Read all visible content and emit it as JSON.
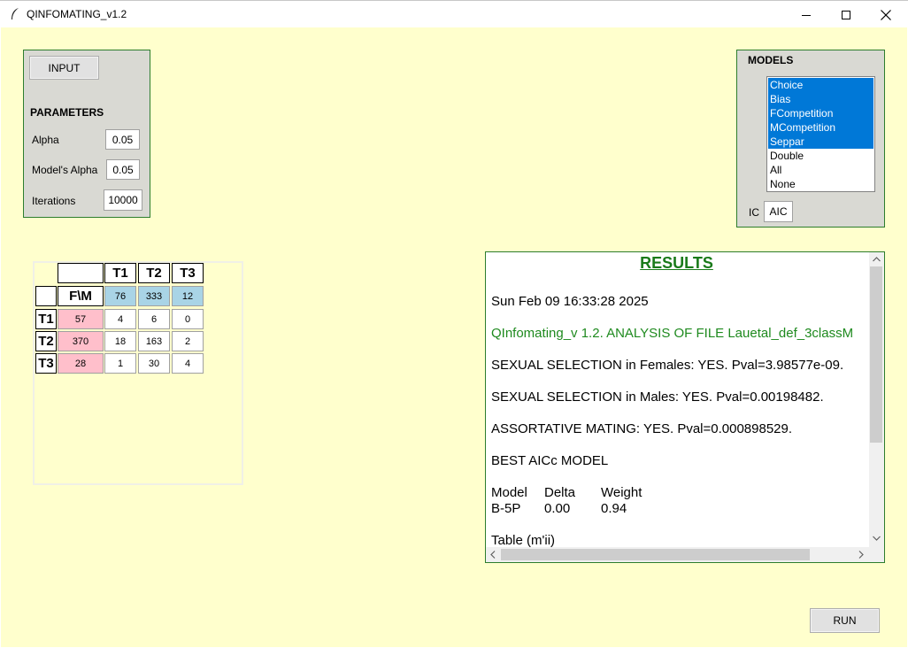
{
  "window": {
    "title": "QINFOMATING_v1.2"
  },
  "input_button": "INPUT",
  "parameters": {
    "heading": "PARAMETERS",
    "alpha_label": "Alpha",
    "alpha_value": "0.05",
    "model_alpha_label": "Model's Alpha",
    "model_alpha_value": "0.05",
    "iterations_label": "Iterations",
    "iterations_value": "10000"
  },
  "models": {
    "heading": "MODELS",
    "items": [
      {
        "label": "Choice",
        "selected": true
      },
      {
        "label": "Bias",
        "selected": true
      },
      {
        "label": "FCompetition",
        "selected": true
      },
      {
        "label": "MCompetition",
        "selected": true
      },
      {
        "label": "Seppar",
        "selected": true
      },
      {
        "label": "Double",
        "selected": false
      },
      {
        "label": "All",
        "selected": false
      },
      {
        "label": "None",
        "selected": false
      }
    ],
    "ic_label": "IC",
    "ic_value": "AIC"
  },
  "table": {
    "corner": "F\\M",
    "col_headers": [
      "T1",
      "T2",
      "T3"
    ],
    "col_totals": [
      "76",
      "333",
      "12"
    ],
    "row_headers": [
      "T1",
      "T2",
      "T3"
    ],
    "row_totals": [
      "57",
      "370",
      "28"
    ],
    "cells": [
      [
        "4",
        "6",
        "0"
      ],
      [
        "18",
        "163",
        "2"
      ],
      [
        "1",
        "30",
        "4"
      ]
    ]
  },
  "results": {
    "title": "RESULTS",
    "date": "Sun Feb 09 16:33:28 2025",
    "analysis": "QInfomating_v 1.2. ANALYSIS OF FILE  Lauetal_def_3classM",
    "females": "SEXUAL SELECTION in Females: YES. Pval=3.98577e-09.",
    "males": "SEXUAL SELECTION in Males: YES. Pval=0.00198482.",
    "assortative": "ASSORTATIVE MATING: YES. Pval=0.000898529.",
    "best": "BEST AICc MODEL",
    "model_header": [
      "Model",
      "Delta",
      "Weight"
    ],
    "model_row": [
      "B-5P",
      "0.00",
      "0.94"
    ],
    "table_label": "Table (m'ii)"
  },
  "run_button": "RUN",
  "colors": {
    "background": "#ffffcd",
    "panel": "#d9d9d3",
    "frame_border": "#2d7d2d",
    "selection": "#0078d7",
    "title_green": "#1a7a1a",
    "blue_cell": "#a9d4e6",
    "pink_cell": "#ffbfcb"
  }
}
